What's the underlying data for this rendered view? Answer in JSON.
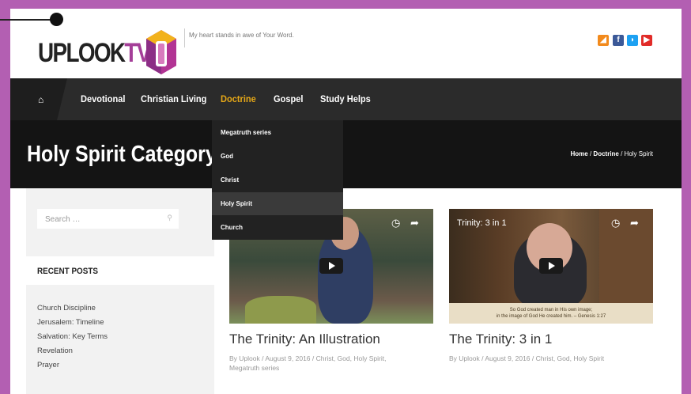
{
  "site": {
    "logo_main": "UPLOOK",
    "logo_accent": "TV",
    "tagline": "My heart stands in awe of Your Word.",
    "colors": {
      "brand": "#a43e98",
      "accent": "#e6a817",
      "nav": "#2b2b2b"
    }
  },
  "social": [
    {
      "name": "rss-icon",
      "glyph": "◢"
    },
    {
      "name": "facebook-icon",
      "glyph": "f"
    },
    {
      "name": "twitter-icon",
      "glyph": "◗"
    },
    {
      "name": "youtube-icon",
      "glyph": "▶"
    }
  ],
  "nav": {
    "home_glyph": "⌂",
    "items": [
      {
        "label": "Devotional"
      },
      {
        "label": "Christian Living"
      },
      {
        "label": "Doctrine",
        "active": true
      },
      {
        "label": "Gospel"
      },
      {
        "label": "Study Helps"
      }
    ]
  },
  "dropdown": {
    "items": [
      {
        "label": "Megatruth series"
      },
      {
        "label": "God"
      },
      {
        "label": "Christ"
      },
      {
        "label": "Holy Spirit",
        "active": true
      },
      {
        "label": "Church"
      }
    ]
  },
  "page": {
    "title": "Holy Spirit Category",
    "breadcrumb": {
      "home": "Home",
      "sep1": " / ",
      "parent": "Doctrine",
      "sep2": " / ",
      "current": "Holy Spirit"
    }
  },
  "sidebar": {
    "search_placeholder": "Search …",
    "search_glyph": "⚲",
    "recent_title": "RECENT POSTS",
    "recent_posts": [
      {
        "label": "Church Discipline"
      },
      {
        "label": "Jerusalem: Timeline"
      },
      {
        "label": "Salvation: Key Terms"
      },
      {
        "label": "Revelation"
      },
      {
        "label": "Prayer"
      }
    ]
  },
  "posts": [
    {
      "title": "The Trinity: An Illustration",
      "meta_line1": "By Uplook / August 9, 2016 / Christ, God, Holy Spirit,",
      "meta_line2": "Megatruth series",
      "video": {
        "clock_glyph": "◷",
        "share_glyph": "➦"
      }
    },
    {
      "title": "The Trinity: 3 in 1",
      "meta_line1": "By Uplook / August 9, 2016 / Christ, God, Holy Spirit",
      "video": {
        "caption": "Trinity: 3 in 1",
        "clock_glyph": "◷",
        "share_glyph": "➦",
        "verse_line1": "So God created man in His own image;",
        "verse_line2": "in the image of God He created him. – Genesis 1:27"
      }
    }
  ]
}
